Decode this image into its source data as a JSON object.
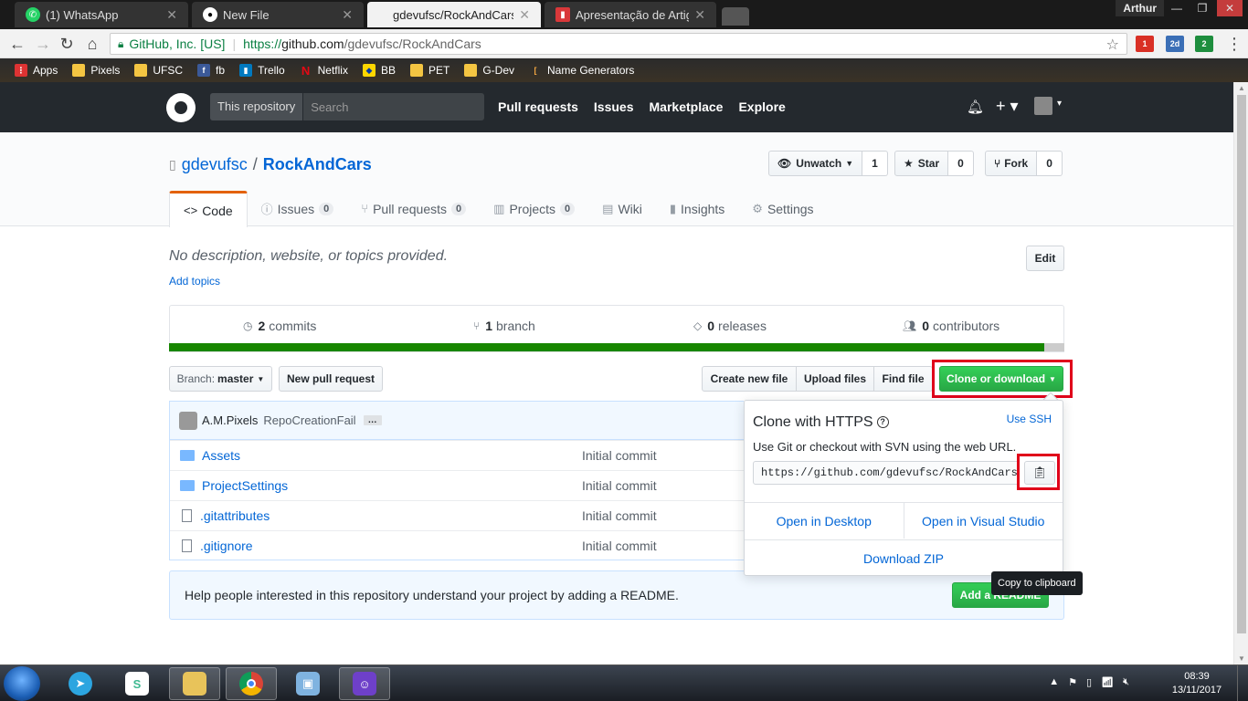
{
  "browser": {
    "tabs": [
      {
        "title": "(1) WhatsApp",
        "icon": "whatsapp-icon"
      },
      {
        "title": "New File",
        "icon": "github-icon"
      },
      {
        "title": "gdevufsc/RockAndCars",
        "icon": "none"
      },
      {
        "title": "Apresentação de Artigos",
        "icon": "trello-icon"
      }
    ],
    "user": "Arthur",
    "secure_label": "GitHub, Inc. [US]",
    "url_proto": "https://",
    "url_host": "github.com",
    "url_path": "/gdevufsc/RockAndCars",
    "ext_badges": [
      "1",
      "2d",
      "2"
    ],
    "bookmarks": [
      "Apps",
      "Pixels",
      "UFSC",
      "fb",
      "Trello",
      "Netflix",
      "BB",
      "PET",
      "G-Dev",
      "Name Generators"
    ]
  },
  "gh": {
    "search_scope": "This repository",
    "search_placeholder": "Search",
    "nav": [
      "Pull requests",
      "Issues",
      "Marketplace",
      "Explore"
    ],
    "owner": "gdevufsc",
    "repo": "RockAndCars",
    "unwatch_label": "Unwatch",
    "watch_count": "1",
    "star_label": "Star",
    "star_count": "0",
    "fork_label": "Fork",
    "fork_count": "0",
    "tabs": [
      {
        "label": "Code"
      },
      {
        "label": "Issues",
        "count": "0"
      },
      {
        "label": "Pull requests",
        "count": "0"
      },
      {
        "label": "Projects",
        "count": "0"
      },
      {
        "label": "Wiki"
      },
      {
        "label": "Insights"
      },
      {
        "label": "Settings"
      }
    ],
    "description": "No description, website, or topics provided.",
    "add_topics": "Add topics",
    "edit_label": "Edit",
    "summary": {
      "commits_num": "2",
      "commits_label": "commits",
      "branch_num": "1",
      "branch_label": "branch",
      "releases_num": "0",
      "releases_label": "releases",
      "contributors_num": "0",
      "contributors_label": "contributors"
    },
    "language_bar_fraction": 0.978,
    "branch_prefix": "Branch:",
    "branch_name": "master",
    "new_pr": "New pull request",
    "create_file": "Create new file",
    "upload_files": "Upload files",
    "find_file": "Find file",
    "clone_download": "Clone or download",
    "commit": {
      "author": "A.M.Pixels",
      "message": "RepoCreationFail",
      "ellipsis": "…"
    },
    "files": [
      {
        "name": "Assets",
        "type": "folder",
        "message": "Initial commit"
      },
      {
        "name": "ProjectSettings",
        "type": "folder",
        "message": "Initial commit"
      },
      {
        "name": ".gitattributes",
        "type": "file",
        "message": "Initial commit"
      },
      {
        "name": ".gitignore",
        "type": "file",
        "message": "Initial commit"
      }
    ],
    "readme_text": "Help people interested in this repository understand your project by adding a README.",
    "add_readme": "Add a README",
    "clone": {
      "title": "Clone with HTTPS",
      "use_ssh": "Use SSH",
      "desc": "Use Git or checkout with SVN using the web URL.",
      "url": "https://github.com/gdevufsc/RockAndCars.git",
      "tooltip": "Copy to clipboard",
      "open_desktop": "Open in Desktop",
      "open_vs": "Open in Visual Studio",
      "download_zip": "Download ZIP"
    }
  },
  "taskbar": {
    "time": "08:39",
    "date": "13/11/2017"
  },
  "colors": {
    "accent_green": "#28a745",
    "link_blue": "#0366d6",
    "highlight_red": "#e0001a",
    "header_dark": "#24292e"
  }
}
